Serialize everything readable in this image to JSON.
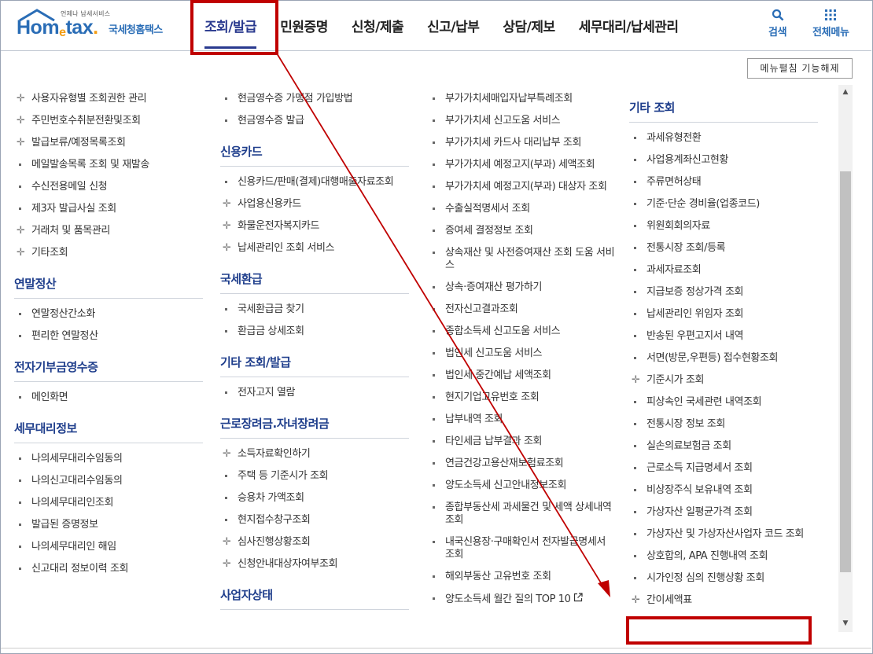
{
  "header": {
    "logo_small": "언제나 납세서비스",
    "logo_word_a": "Hom",
    "logo_word_e": "e",
    "logo_word_b": "tax",
    "logo_word_dot": ".",
    "logo_kr": "국세청홈택스",
    "nav": [
      "조회/발급",
      "민원증명",
      "신청/제출",
      "신고/납부",
      "상담/제보",
      "세무대리/납세관리"
    ],
    "search_label": "검색",
    "menu_label": "전체메뉴"
  },
  "edit_button": "메뉴펼침 기능해제",
  "colors": {
    "accent": "#1f3e8c",
    "highlight": "#c00000",
    "logo": "#2a6db6"
  },
  "columns": [
    [
      {
        "type": "item",
        "icon": "plus",
        "label": "사용자유형별 조회권한 관리"
      },
      {
        "type": "item",
        "icon": "plus",
        "label": "주민번호수취분전환및조회"
      },
      {
        "type": "item",
        "icon": "plus",
        "label": "발급보류/예정목록조회"
      },
      {
        "type": "item",
        "icon": "dot",
        "label": "메일발송목록 조회 및 재발송"
      },
      {
        "type": "item",
        "icon": "dot",
        "label": "수신전용메일 신청"
      },
      {
        "type": "item",
        "icon": "dot",
        "label": "제3자 발급사실 조회"
      },
      {
        "type": "item",
        "icon": "plus",
        "label": "거래처 및 품목관리"
      },
      {
        "type": "item",
        "icon": "plus",
        "label": "기타조회"
      },
      {
        "type": "title",
        "label": "연말정산"
      },
      {
        "type": "item",
        "icon": "dot",
        "label": "연말정산간소화"
      },
      {
        "type": "item",
        "icon": "dot",
        "label": "편리한 연말정산"
      },
      {
        "type": "title",
        "label": "전자기부금영수증"
      },
      {
        "type": "item",
        "icon": "dot",
        "label": "메인화면"
      },
      {
        "type": "title",
        "label": "세무대리정보"
      },
      {
        "type": "item",
        "icon": "dot",
        "label": "나의세무대리수임동의"
      },
      {
        "type": "item",
        "icon": "dot",
        "label": "나의신고대리수임동의"
      },
      {
        "type": "item",
        "icon": "dot",
        "label": "나의세무대리인조회"
      },
      {
        "type": "item",
        "icon": "dot",
        "label": "발급된 증명정보"
      },
      {
        "type": "item",
        "icon": "dot",
        "label": "나의세무대리인 해임"
      },
      {
        "type": "item",
        "icon": "dot",
        "label": "신고대리 정보이력 조회"
      }
    ],
    [
      {
        "type": "item",
        "icon": "dot",
        "label": "현금영수증 가맹점 가입방법"
      },
      {
        "type": "item",
        "icon": "dot",
        "label": "현금영수증 발급"
      },
      {
        "type": "title",
        "label": "신용카드"
      },
      {
        "type": "item",
        "icon": "dot",
        "label": "신용카드/판매(결제)대행매출자료조회"
      },
      {
        "type": "item",
        "icon": "plus",
        "label": "사업용신용카드"
      },
      {
        "type": "item",
        "icon": "plus",
        "label": "화물운전자복지카드"
      },
      {
        "type": "item",
        "icon": "plus",
        "label": "납세관리인 조회 서비스"
      },
      {
        "type": "title",
        "label": "국세환급"
      },
      {
        "type": "item",
        "icon": "dot",
        "label": "국세환급금 찾기"
      },
      {
        "type": "item",
        "icon": "dot",
        "label": "환급금 상세조회"
      },
      {
        "type": "title",
        "label": "기타 조회/발급"
      },
      {
        "type": "item",
        "icon": "dot",
        "label": "전자고지 열람"
      },
      {
        "type": "title",
        "label": "근로장려금.자녀장려금"
      },
      {
        "type": "item",
        "icon": "plus",
        "label": "소득자료확인하기"
      },
      {
        "type": "item",
        "icon": "dot",
        "label": "주택 등 기준시가 조회"
      },
      {
        "type": "item",
        "icon": "dot",
        "label": "승용차 가액조회"
      },
      {
        "type": "item",
        "icon": "dot",
        "label": "현지접수창구조회"
      },
      {
        "type": "item",
        "icon": "plus",
        "label": "심사진행상황조회"
      },
      {
        "type": "item",
        "icon": "plus",
        "label": "신청안내대상자여부조회"
      },
      {
        "type": "title",
        "label": "사업자상태"
      }
    ],
    [
      {
        "type": "item",
        "icon": "dot",
        "label": "부가가치세매입자납부특례조회"
      },
      {
        "type": "item",
        "icon": "dot",
        "label": "부가가치세 신고도움 서비스"
      },
      {
        "type": "item",
        "icon": "dot",
        "label": "부가가치세 카드사 대리납부 조회"
      },
      {
        "type": "item",
        "icon": "dot",
        "label": "부가가치세 예정고지(부과) 세액조회"
      },
      {
        "type": "item",
        "icon": "dot",
        "label": "부가가치세 예정고지(부과) 대상자 조회"
      },
      {
        "type": "item",
        "icon": "dot",
        "label": "수출실적명세서 조회"
      },
      {
        "type": "item",
        "icon": "dot",
        "label": "증여세 결정정보 조회"
      },
      {
        "type": "item",
        "icon": "dot",
        "label": "상속재산 및 사전증여재산 조회 도움 서비스"
      },
      {
        "type": "item",
        "icon": "dot",
        "label": "상속·증여재산 평가하기"
      },
      {
        "type": "item",
        "icon": "dot",
        "label": "전자신고결과조회"
      },
      {
        "type": "item",
        "icon": "dot",
        "label": "종합소득세 신고도움 서비스"
      },
      {
        "type": "item",
        "icon": "dot",
        "label": "법인세 신고도움 서비스"
      },
      {
        "type": "item",
        "icon": "dot",
        "label": "법인세 중간예납 세액조회"
      },
      {
        "type": "item",
        "icon": "dot",
        "label": "현지기업고유번호 조회"
      },
      {
        "type": "item",
        "icon": "dot",
        "label": "납부내역 조회"
      },
      {
        "type": "item",
        "icon": "dot",
        "label": "타인세금 납부결과 조회"
      },
      {
        "type": "item",
        "icon": "dot",
        "label": "연금건강고용산재보험료조회"
      },
      {
        "type": "item",
        "icon": "dot",
        "label": "양도소득세 신고안내정보조회"
      },
      {
        "type": "item",
        "icon": "dot",
        "label": "종합부동산세 과세물건 및 세액 상세내역 조회"
      },
      {
        "type": "item",
        "icon": "dot",
        "label": "내국신용장·구매확인서 전자발급명세서 조회"
      },
      {
        "type": "item",
        "icon": "dot",
        "label": "해외부동산 고유번호 조회"
      },
      {
        "type": "item",
        "icon": "dot",
        "label": "양도소득세 월간 질의 TOP 10",
        "ext": true
      }
    ],
    [
      {
        "type": "title",
        "label": "기타 조회"
      },
      {
        "type": "item",
        "icon": "dot",
        "label": "과세유형전환"
      },
      {
        "type": "item",
        "icon": "dot",
        "label": "사업용계좌신고현황"
      },
      {
        "type": "item",
        "icon": "dot",
        "label": "주류면허상태"
      },
      {
        "type": "item",
        "icon": "dot",
        "label": "기준·단순 경비율(업종코드)"
      },
      {
        "type": "item",
        "icon": "dot",
        "label": "위원회회의자료"
      },
      {
        "type": "item",
        "icon": "dot",
        "label": "전통시장 조회/등록"
      },
      {
        "type": "item",
        "icon": "dot",
        "label": "과세자료조회"
      },
      {
        "type": "item",
        "icon": "dot",
        "label": "지급보증 정상가격 조회"
      },
      {
        "type": "item",
        "icon": "dot",
        "label": "납세관리인 위임자 조회"
      },
      {
        "type": "item",
        "icon": "dot",
        "label": "반송된 우편고지서 내역"
      },
      {
        "type": "item",
        "icon": "dot",
        "label": "서면(방문,우편등) 접수현황조회"
      },
      {
        "type": "item",
        "icon": "plus",
        "label": "기준시가 조회"
      },
      {
        "type": "item",
        "icon": "dot",
        "label": "피상속인 국세관련 내역조회"
      },
      {
        "type": "item",
        "icon": "dot",
        "label": "전통시장 정보 조회"
      },
      {
        "type": "item",
        "icon": "dot",
        "label": "실손의료보험금 조회"
      },
      {
        "type": "item",
        "icon": "dot",
        "label": "근로소득 지급명세서 조회"
      },
      {
        "type": "item",
        "icon": "dot",
        "label": "비상장주식 보유내역 조회"
      },
      {
        "type": "item",
        "icon": "dot",
        "label": "가상자산 일평균가격 조회"
      },
      {
        "type": "item",
        "icon": "dot",
        "label": "가상자산 및 가상자산사업자 코드 조회"
      },
      {
        "type": "item",
        "icon": "dot",
        "label": "상호합의, APA 진행내역 조회"
      },
      {
        "type": "item",
        "icon": "dot",
        "label": "시가인정 심의 진행상황 조회"
      },
      {
        "type": "item",
        "icon": "plus",
        "label": "간이세액표"
      }
    ]
  ]
}
